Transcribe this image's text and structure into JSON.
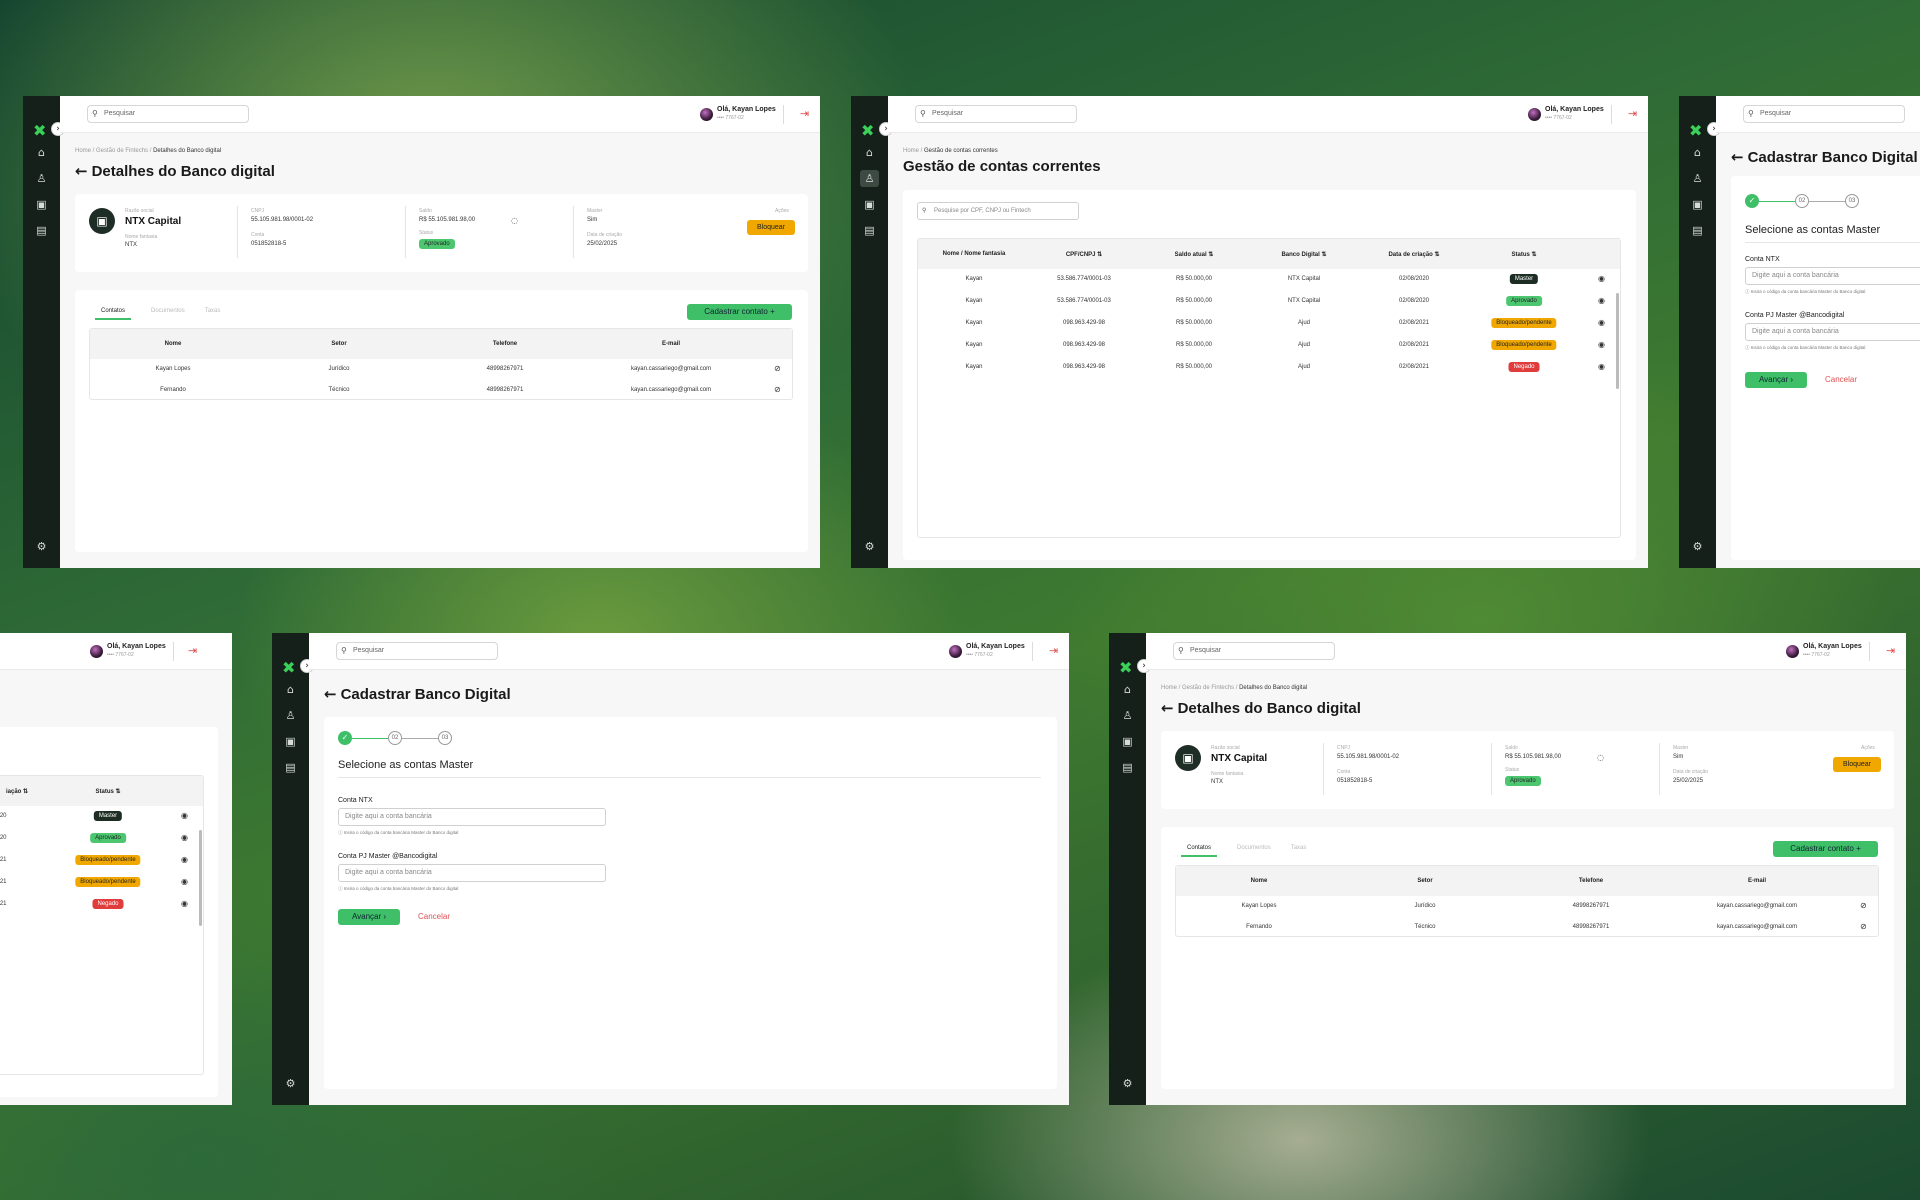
{
  "common": {
    "logo": "✖",
    "collapse_icon": "›",
    "search_placeholder": "Pesquisar",
    "user_greeting": "Olá, Kayan Lopes",
    "user_id": "•••• 7767-02",
    "back_arrow": "←"
  },
  "details": {
    "breadcrumb_home": "Home /",
    "breadcrumb_mid": "Gestão de Fintechs /",
    "breadcrumb_current": "Detalhes do Banco digital",
    "title": "Detalhes do Banco digital",
    "razao_label": "Razão social",
    "razao_value": "NTX Capital",
    "fantasia_label": "Nome fantasia",
    "fantasia_value": "NTX",
    "cnpj_label": "CNPJ",
    "cnpj_value": "55.105.981.98/0001-02",
    "conta_label": "Conta",
    "conta_value": "051852818-5",
    "saldo_label": "Saldo",
    "saldo_value": "R$ 55.105.981.98,00",
    "status_label": "Status",
    "status_value": "Aprovado",
    "master_label": "Master",
    "master_value": "Sim",
    "data_label": "Data de criação",
    "data_value": "25/02/2025",
    "acoes_label": "Ações",
    "bloquear": "Bloquear",
    "tabs": [
      "Contatos",
      "Documentos",
      "Taxas"
    ],
    "cadastrar_contato": "Cadastrar contato  +",
    "columns": [
      "Nome",
      "Setor",
      "Telefone",
      "E-mail"
    ],
    "rows": [
      [
        "Kayan Lopes",
        "Jurídico",
        "48998267971",
        "kayan.cassariego@gmail.com"
      ],
      [
        "Fernando",
        "Técnico",
        "48998267971",
        "kayan.cassariego@gmail.com"
      ]
    ]
  },
  "accounts": {
    "breadcrumb_home": "Home /",
    "breadcrumb_current": "Gestão de contas correntes",
    "title": "Gestão de contas correntes",
    "search_placeholder": "Pesquise por CPF, CNPJ ou Fintech",
    "columns": [
      "Nome / Nome fantasia",
      "CPF/CNPJ ⇅",
      "Saldo atual ⇅",
      "Banco Digital ⇅",
      "Data de criação ⇅",
      "Status ⇅"
    ],
    "rows": [
      {
        "nome": "Kayan",
        "doc": "53.586.774/0001-03",
        "saldo": "R$ 50.000,00",
        "banco": "NTX Capital",
        "data": "02/08/2020",
        "status": "Master",
        "tone": "dark"
      },
      {
        "nome": "Kayan",
        "doc": "53.586.774/0001-03",
        "saldo": "R$ 50.000,00",
        "banco": "NTX Capital",
        "data": "02/08/2020",
        "status": "Aprovado",
        "tone": "green"
      },
      {
        "nome": "Kayan",
        "doc": "098.963.429-98",
        "saldo": "R$ 50.000,00",
        "banco": "Ajud",
        "data": "02/08/2021",
        "status": "Bloqueado/pendente",
        "tone": "amber"
      },
      {
        "nome": "Kayan",
        "doc": "098.963.429-98",
        "saldo": "R$ 50.000,00",
        "banco": "Ajud",
        "data": "02/08/2021",
        "status": "Bloqueado/pendente",
        "tone": "amber"
      },
      {
        "nome": "Kayan",
        "doc": "098.963.429-98",
        "saldo": "R$ 50.000,00",
        "banco": "Ajud",
        "data": "02/08/2021",
        "status": "Negado",
        "tone": "red"
      }
    ],
    "partial_dates": [
      "/2020",
      "/2020",
      "/2021",
      "/2021",
      "/2021"
    ],
    "partial_col": "iação ⇅",
    "status_col": "Status ⇅"
  },
  "register": {
    "title": "Cadastrar Banco Digital",
    "step2": "02",
    "step3": "03",
    "section": "Selecione as contas Master",
    "conta_ntx_label": "Conta NTX",
    "input_placeholder": "Digite aqui a conta bancária",
    "hint": "ⓘ Insira o código da conta bancária Master do Banco digital",
    "conta_pj_label": "Conta PJ Master @Bancodigital",
    "avancar": "Avançar  ›",
    "cancelar": "Cancelar"
  },
  "colors": {
    "accent_green": "#3fbf68",
    "sidebar": "#142019",
    "amber": "#f0a800",
    "red": "#e03c3c"
  },
  "icons": [
    "home-icon",
    "user-icon",
    "briefcase-icon",
    "card-icon",
    "gear-icon",
    "search-icon",
    "logout-icon",
    "eye-icon",
    "eye-off-icon",
    "block-icon",
    "check-icon"
  ]
}
